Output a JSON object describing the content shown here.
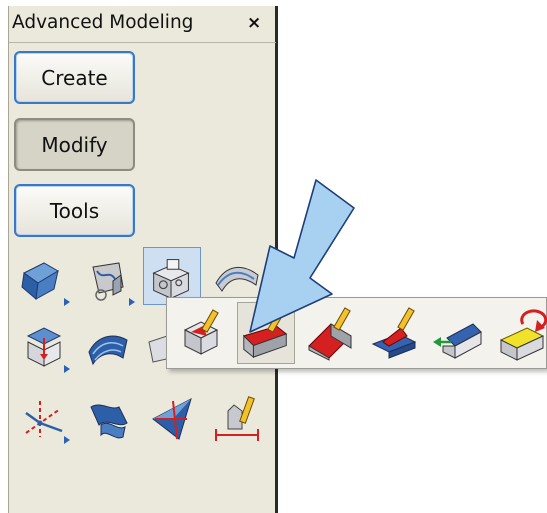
{
  "panel": {
    "title": "Advanced Modeling",
    "close_glyph": "×"
  },
  "modes": [
    {
      "label": "Create",
      "state": "normal"
    },
    {
      "label": "Modify",
      "state": "active"
    },
    {
      "label": "Tools",
      "state": "normal"
    }
  ],
  "tool_icons": [
    "blue-solid-icon",
    "swept-solid-icon",
    "shell-box-icon",
    "curved-sweep-icon",
    "draft-box-icon",
    "curved-surface-icon",
    "partial-icon",
    "axis-system-icon",
    "twisted-surface-icon",
    "blend-surface-icon",
    "measure-pencil-icon"
  ],
  "flyout_icons": [
    "edit-solid-pencil-icon",
    "edit-red-face-pencil-icon",
    "edit-wedge-pencil-icon",
    "edit-plate-pencil-icon",
    "move-face-icon",
    "rotate-face-icon"
  ],
  "colors": {
    "panel_bg": "#ebe9dc",
    "button_border": "#3a78c6",
    "arrow_fill": "#a8d0f0",
    "accent_red": "#d42020"
  }
}
